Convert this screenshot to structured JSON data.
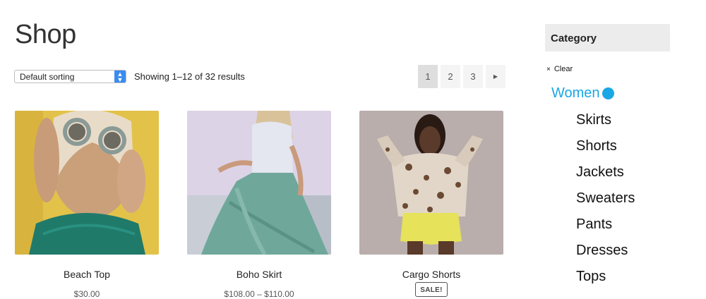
{
  "page": {
    "title": "Shop"
  },
  "toolbar": {
    "sorting_value": "Default sorting",
    "result_count": "Showing 1–12 of 32 results"
  },
  "pagination": {
    "pages": [
      "1",
      "2",
      "3"
    ],
    "current": "1",
    "next_icon": "triangle-right-icon"
  },
  "products": [
    {
      "name": "Beach Top",
      "price": "$30.00"
    },
    {
      "name": "Boho Skirt",
      "price": "$108.00 – $110.00"
    },
    {
      "name": "Cargo Shorts",
      "badge": "SALE!"
    }
  ],
  "sidebar": {
    "title": "Category",
    "clear_label": "Clear",
    "active_category": "Women",
    "subcategories": [
      "Skirts",
      "Shorts",
      "Jackets",
      "Sweaters",
      "Pants",
      "Dresses",
      "Tops"
    ]
  },
  "colors": {
    "accent": "#1aa7e6",
    "select_button": "#3a8cf0"
  }
}
